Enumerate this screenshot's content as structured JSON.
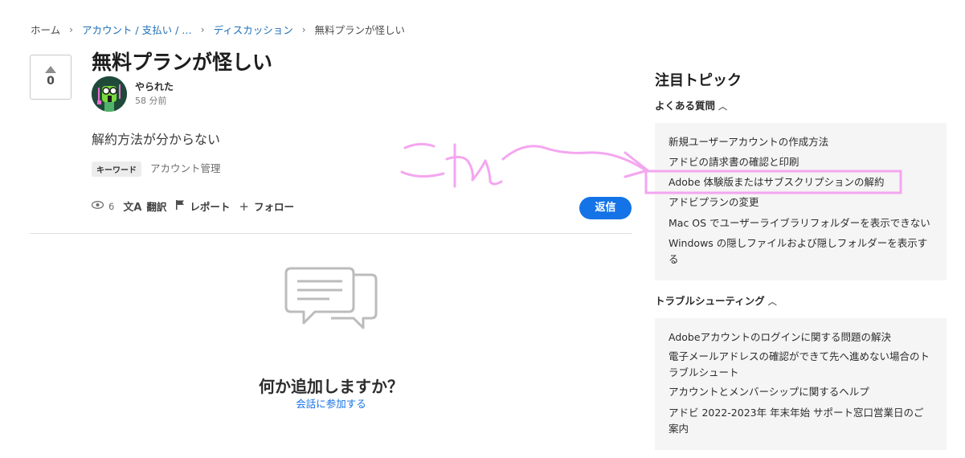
{
  "breadcrumb": {
    "home": "ホーム",
    "account": "アカウント / 支払い / …",
    "discussion": "ディスカッション",
    "current": "無料プランが怪しい",
    "separator": "›"
  },
  "post": {
    "vote_count": "0",
    "title": "無料プランが怪しい",
    "author": "やられた",
    "time": "58 分前",
    "body": "解約方法が分からない",
    "tag_label": "キーワード",
    "tag_value": "アカウント管理",
    "views": "6",
    "translate_label": "翻訳",
    "report_label": "レポート",
    "follow_label": "フォロー",
    "reply_label": "返信"
  },
  "empty_state": {
    "title": "何か追加しますか？",
    "link": "会話に参加する"
  },
  "sidebar": {
    "title": "注目トピック",
    "sections": [
      {
        "heading": "よくある質問",
        "items": [
          "新規ユーザーアカウントの作成方法",
          "アドビの請求書の確認と印刷",
          "Adobe 体験版またはサブスクリプションの解約",
          "アドビプランの変更",
          "Mac OS でユーザーライブラリフォルダーを表示できない",
          "Windows の隠しファイルおよび隠しフォルダーを表示する"
        ]
      },
      {
        "heading": "トラブルシューティング",
        "items": [
          "Adobeアカウントのログインに関する問題の解決",
          "電子メールアドレスの確認ができて先へ進めない場合のトラブルシュート",
          "アカウントとメンバーシップに関するヘルプ",
          "アドビ 2022-2023年 年末年始 サポート窓口営業日のご案内"
        ]
      }
    ]
  },
  "annotation": {
    "text": "これ",
    "color": "#f4a6f0"
  },
  "colors": {
    "accent": "#1473e6",
    "panel": "#f5f5f5"
  }
}
